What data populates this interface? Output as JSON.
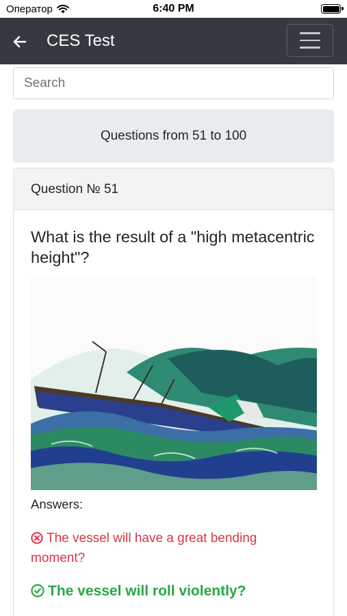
{
  "status_bar": {
    "carrier": "Оператор",
    "time": "6:40 PM"
  },
  "navbar": {
    "title": "CES Test",
    "back_icon": "arrow-left-icon",
    "menu_icon": "hamburger-icon"
  },
  "search": {
    "placeholder": "Search",
    "value": ""
  },
  "range": {
    "label": "Questions from 51 to 100"
  },
  "question_card": {
    "header": "Question № 51",
    "question_text": "What is the result of a \"high metacentric height\"?",
    "image_alt": "ship-rolling-in-storm-illustration",
    "answers_label": "Answers:",
    "answers": [
      {
        "text": "The vessel will have a great bending moment?",
        "status": "wrong",
        "icon": "x-circle-icon",
        "color": "#dc3545"
      },
      {
        "text": "The vessel will roll violently?",
        "status": "correct",
        "icon": "check-circle-icon",
        "color": "#28a745"
      }
    ]
  },
  "colors": {
    "navbar": "#343a40",
    "range_bg": "#e9ecef",
    "card_header_bg": "#f3f3f3"
  }
}
